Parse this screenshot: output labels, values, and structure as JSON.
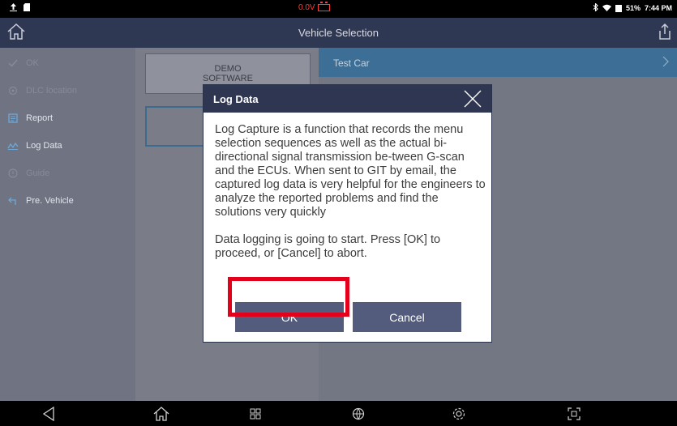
{
  "status_bar": {
    "voltage": "0.0V",
    "battery_percent": "51%",
    "time": "7:44 PM"
  },
  "header": {
    "title": "Vehicle Selection"
  },
  "sidebar": {
    "items": [
      {
        "label": "OK",
        "icon": "check-icon",
        "enabled": false
      },
      {
        "label": "DLC location",
        "icon": "location-icon",
        "enabled": false
      },
      {
        "label": "Report",
        "icon": "report-icon",
        "enabled": true
      },
      {
        "label": "Log Data",
        "icon": "log-data-icon",
        "enabled": true
      },
      {
        "label": "Guide",
        "icon": "guide-icon",
        "enabled": false
      },
      {
        "label": "Pre. Vehicle",
        "icon": "back-arrow-icon",
        "enabled": true
      }
    ]
  },
  "middle": {
    "demo_card": {
      "line1": "DEMO",
      "line2": "SOFTWARE"
    }
  },
  "vehicle_list": {
    "items": [
      {
        "label": "Test Car"
      }
    ]
  },
  "dialog": {
    "title": "Log Data",
    "paragraph1": "Log Capture is a function that records the menu selection sequences as well as the actual bi-directional signal transmission be-tween G-scan and the ECUs. When sent to GIT by email,  the captured log data is very helpful for the engineers to analyze the reported problems and find the solutions very quickly",
    "paragraph2": "Data logging is going to start.  Press [OK] to proceed,  or [Cancel] to abort.",
    "ok_label": "OK",
    "cancel_label": "Cancel"
  },
  "colors": {
    "header_bg": "#2f3853",
    "sidebar_bg": "#6f7382",
    "vehicle_row_bg": "#3d6f96",
    "button_bg": "#535c7c",
    "highlight": "#e3001b",
    "voltage_warning": "#ff3b3b"
  }
}
